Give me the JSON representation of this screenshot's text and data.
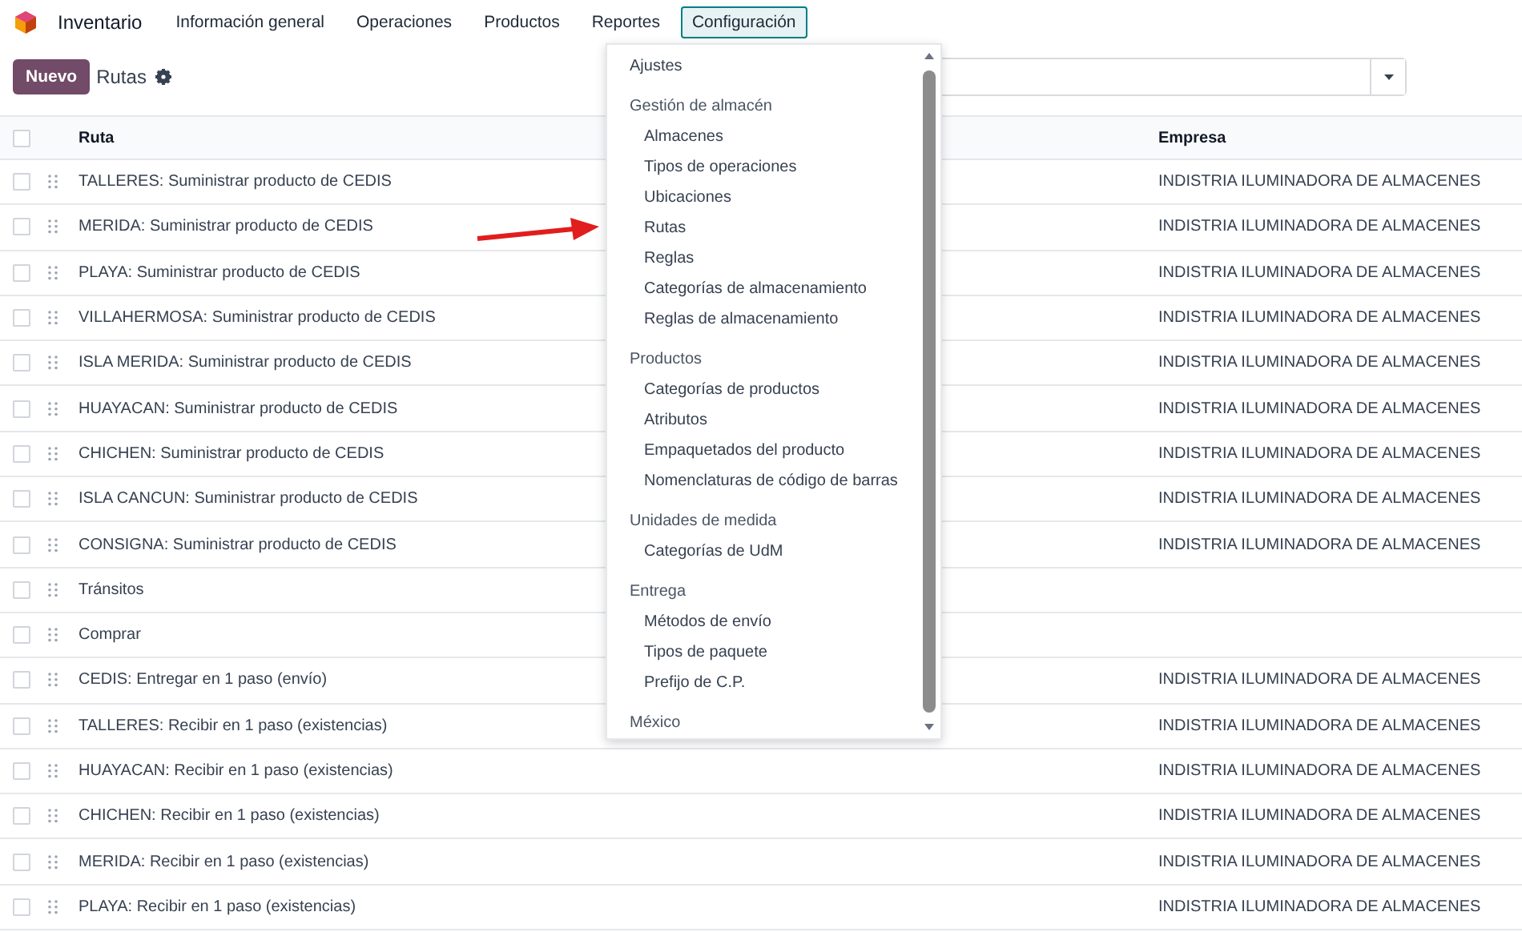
{
  "app": {
    "name": "Inventario"
  },
  "nav": [
    {
      "label": "Información general",
      "selected": false
    },
    {
      "label": "Operaciones",
      "selected": false
    },
    {
      "label": "Productos",
      "selected": false
    },
    {
      "label": "Reportes",
      "selected": false
    },
    {
      "label": "Configuración",
      "selected": true
    }
  ],
  "toolbar": {
    "new_button": "Nuevo",
    "title": "Rutas"
  },
  "table": {
    "columns": [
      "Ruta",
      "Empresa"
    ],
    "header_checked": false,
    "rows": [
      {
        "ruta": "TALLERES: Suministrar producto de CEDIS",
        "empresa": "INDISTRIA ILUMINADORA DE ALMACENES",
        "checked": false
      },
      {
        "ruta": "MERIDA: Suministrar producto de CEDIS",
        "empresa": "INDISTRIA ILUMINADORA DE ALMACENES",
        "checked": false
      },
      {
        "ruta": "PLAYA: Suministrar producto de CEDIS",
        "empresa": "INDISTRIA ILUMINADORA DE ALMACENES",
        "checked": false
      },
      {
        "ruta": "VILLAHERMOSA: Suministrar producto de CEDIS",
        "empresa": "INDISTRIA ILUMINADORA DE ALMACENES",
        "checked": false
      },
      {
        "ruta": "ISLA MERIDA: Suministrar producto de CEDIS",
        "empresa": "INDISTRIA ILUMINADORA DE ALMACENES",
        "checked": false
      },
      {
        "ruta": "HUAYACAN: Suministrar producto de CEDIS",
        "empresa": "INDISTRIA ILUMINADORA DE ALMACENES",
        "checked": false
      },
      {
        "ruta": "CHICHEN: Suministrar producto de CEDIS",
        "empresa": "INDISTRIA ILUMINADORA DE ALMACENES",
        "checked": false
      },
      {
        "ruta": "ISLA CANCUN: Suministrar producto de CEDIS",
        "empresa": "INDISTRIA ILUMINADORA DE ALMACENES",
        "checked": false
      },
      {
        "ruta": "CONSIGNA: Suministrar producto de CEDIS",
        "empresa": "INDISTRIA ILUMINADORA DE ALMACENES",
        "checked": false
      },
      {
        "ruta": "Tránsitos",
        "checked": false
      },
      {
        "ruta": "Comprar",
        "checked": false
      },
      {
        "ruta": "CEDIS: Entregar en 1 paso (envío)",
        "empresa": "INDISTRIA ILUMINADORA DE ALMACENES",
        "checked": false
      },
      {
        "ruta": "TALLERES: Recibir en 1 paso (existencias)",
        "empresa": "INDISTRIA ILUMINADORA DE ALMACENES",
        "checked": false
      },
      {
        "ruta": "HUAYACAN: Recibir en 1 paso (existencias)",
        "empresa": "INDISTRIA ILUMINADORA DE ALMACENES",
        "checked": false
      },
      {
        "ruta": "CHICHEN: Recibir en 1 paso (existencias)",
        "empresa": "INDISTRIA ILUMINADORA DE ALMACENES",
        "checked": false
      },
      {
        "ruta": "MERIDA: Recibir en 1 paso (existencias)",
        "empresa": "INDISTRIA ILUMINADORA DE ALMACENES",
        "checked": false
      },
      {
        "ruta": "PLAYA: Recibir en 1 paso (existencias)",
        "empresa": "INDISTRIA ILUMINADORA DE ALMACENES",
        "checked": false
      }
    ]
  },
  "dropdown": {
    "items": [
      {
        "kind": "entry",
        "label": "Ajustes"
      },
      {
        "kind": "section",
        "label": "Gestión de almacén"
      },
      {
        "kind": "subentry",
        "label": "Almacenes"
      },
      {
        "kind": "subentry",
        "label": "Tipos de operaciones"
      },
      {
        "kind": "subentry",
        "label": "Ubicaciones"
      },
      {
        "kind": "subentry",
        "label": "Rutas"
      },
      {
        "kind": "subentry",
        "label": "Reglas"
      },
      {
        "kind": "subentry",
        "label": "Categorías de almacenamiento"
      },
      {
        "kind": "subentry",
        "label": "Reglas de almacenamiento"
      },
      {
        "kind": "section",
        "label": "Productos"
      },
      {
        "kind": "subentry",
        "label": "Categorías de productos"
      },
      {
        "kind": "subentry",
        "label": "Atributos"
      },
      {
        "kind": "subentry",
        "label": "Empaquetados del producto"
      },
      {
        "kind": "subentry",
        "label": "Nomenclaturas de código de barras"
      },
      {
        "kind": "section",
        "label": "Unidades de medida"
      },
      {
        "kind": "subentry",
        "label": "Categorías de UdM"
      },
      {
        "kind": "section",
        "label": "Entrega"
      },
      {
        "kind": "subentry",
        "label": "Métodos de envío"
      },
      {
        "kind": "subentry",
        "label": "Tipos de paquete"
      },
      {
        "kind": "subentry",
        "label": "Prefijo de C.P."
      },
      {
        "kind": "section",
        "label": "México"
      }
    ]
  }
}
